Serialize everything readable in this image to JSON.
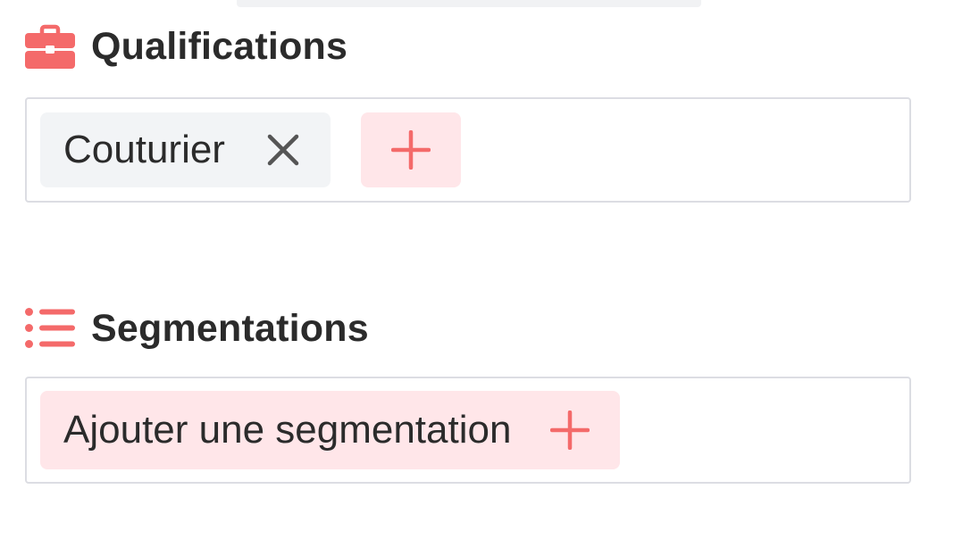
{
  "qualifications": {
    "title": "Qualifications",
    "title_icon": "briefcase-icon",
    "tags": [
      {
        "label": "Couturier",
        "remove_icon": "close-icon"
      }
    ],
    "add_icon": "plus-icon"
  },
  "segmentations": {
    "title": "Segmentations",
    "title_icon": "list-icon",
    "add_label": "Ajouter une segmentation",
    "add_icon": "plus-icon"
  },
  "colors": {
    "accent": "#f46a6a",
    "accent_soft": "#ffe6e9",
    "chip_bg": "#f2f4f6",
    "text": "#2b2b2b",
    "icon_dark": "#555555",
    "border": "#dcdde3"
  }
}
